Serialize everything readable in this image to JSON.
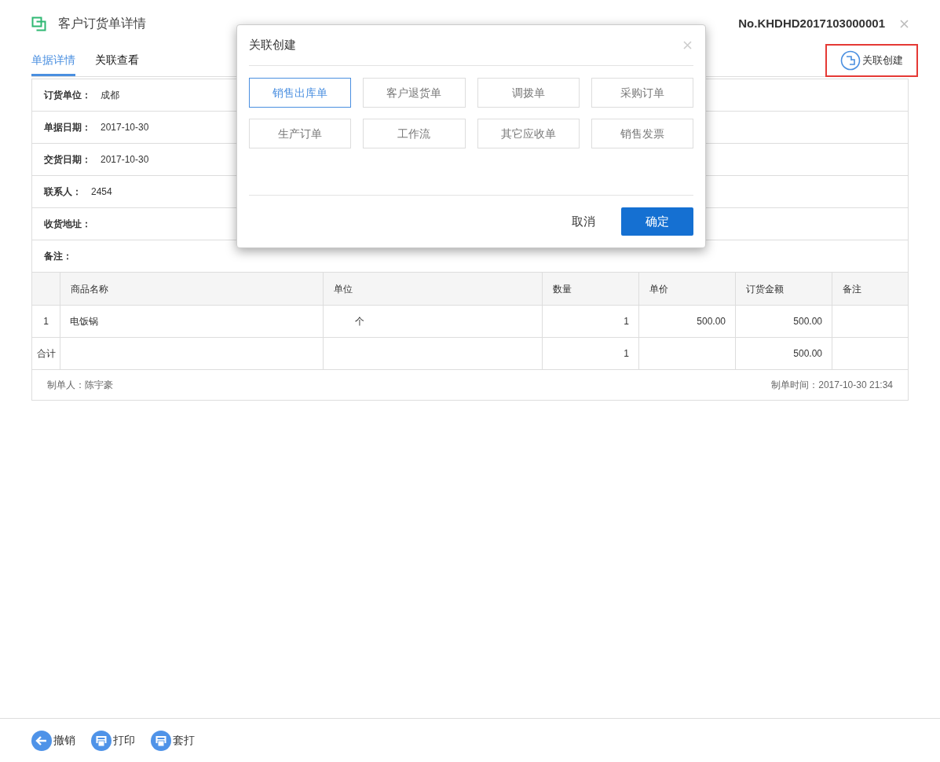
{
  "header": {
    "title": "客户订货单详情",
    "order_no": "No.KHDHD2017103000001"
  },
  "tabs": [
    {
      "label": "单据详情",
      "selected": true
    },
    {
      "label": "关联查看",
      "selected": false
    }
  ],
  "related_create_button": {
    "label": "关联创建",
    "highlighted": true
  },
  "fields": [
    {
      "label": "订货单位：",
      "value": "成都"
    },
    {
      "label": "单据日期：",
      "value": "2017-10-30"
    },
    {
      "label": "交货日期：",
      "value": "2017-10-30"
    },
    {
      "label": "联系人：",
      "value": "2454"
    },
    {
      "label": "收货地址："
    },
    {
      "label": "备注："
    }
  ],
  "table": {
    "columns": [
      null,
      "商品名称",
      "单位",
      "数量",
      "单价",
      "订货金额",
      "备注"
    ],
    "rows": [
      [
        "1",
        "电饭锅",
        "个",
        "1",
        "500.00",
        "500.00",
        null
      ]
    ],
    "total": {
      "label": "合计",
      "quantity": "1",
      "amount": "500.00"
    }
  },
  "footer": {
    "creator": "制单人：陈宇豪",
    "created_time": "制单时间：2017-10-30 21:34"
  },
  "dialog": {
    "title": "关联创建",
    "options": [
      {
        "label": "销售出库单",
        "selected": true
      },
      {
        "label": "客户退货单",
        "selected": false
      },
      {
        "label": "调拨单",
        "selected": false
      },
      {
        "label": "采购订单",
        "selected": false
      },
      {
        "label": "生产订单",
        "selected": false
      },
      {
        "label": "工作流",
        "selected": false
      },
      {
        "label": "其它应收单",
        "selected": false
      },
      {
        "label": "销售发票",
        "selected": false
      }
    ],
    "cancel": "取消",
    "confirm": "确定"
  },
  "bottom_actions": [
    {
      "kind": "back",
      "label": "撤销"
    },
    {
      "kind": "print",
      "label": "打印"
    },
    {
      "kind": "print",
      "label": "套打"
    }
  ]
}
